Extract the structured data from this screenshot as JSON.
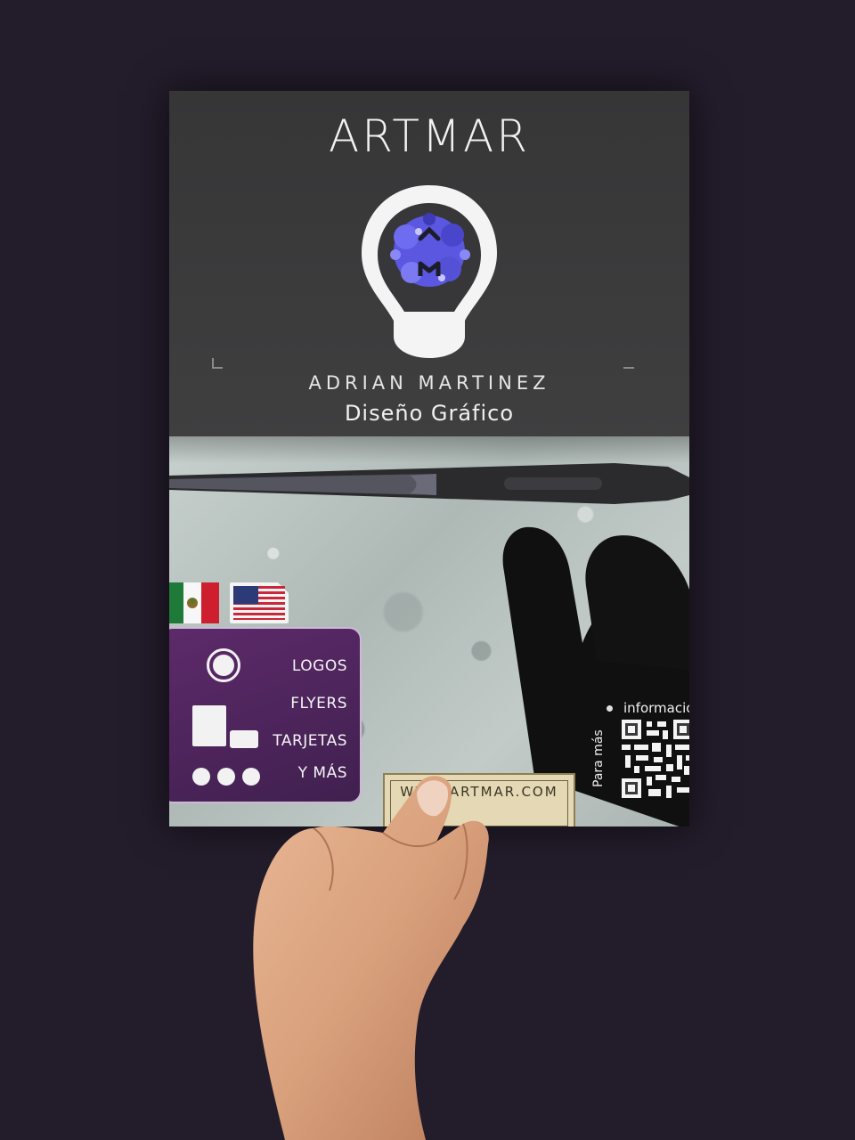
{
  "flyer": {
    "brand": "ARTMAR",
    "designer_name": "ADRIAN MARTINEZ",
    "designer_role": "Diseño Gráfico",
    "flags": [
      "mexico-flag",
      "usa-flag"
    ],
    "services": [
      "LOGOS",
      "FLYERS",
      "TARJETAS",
      "Y MÁS"
    ],
    "website": "WWW.ARTMAR.COM",
    "info_text": "información",
    "para_mas": "Para más",
    "colors": {
      "background": "#231c2b",
      "flyer_dark": "#3a3a3c",
      "services_panel": "#4e2459",
      "bulb_splash": "#5b57e0",
      "tag": "#e4d9b4"
    }
  }
}
